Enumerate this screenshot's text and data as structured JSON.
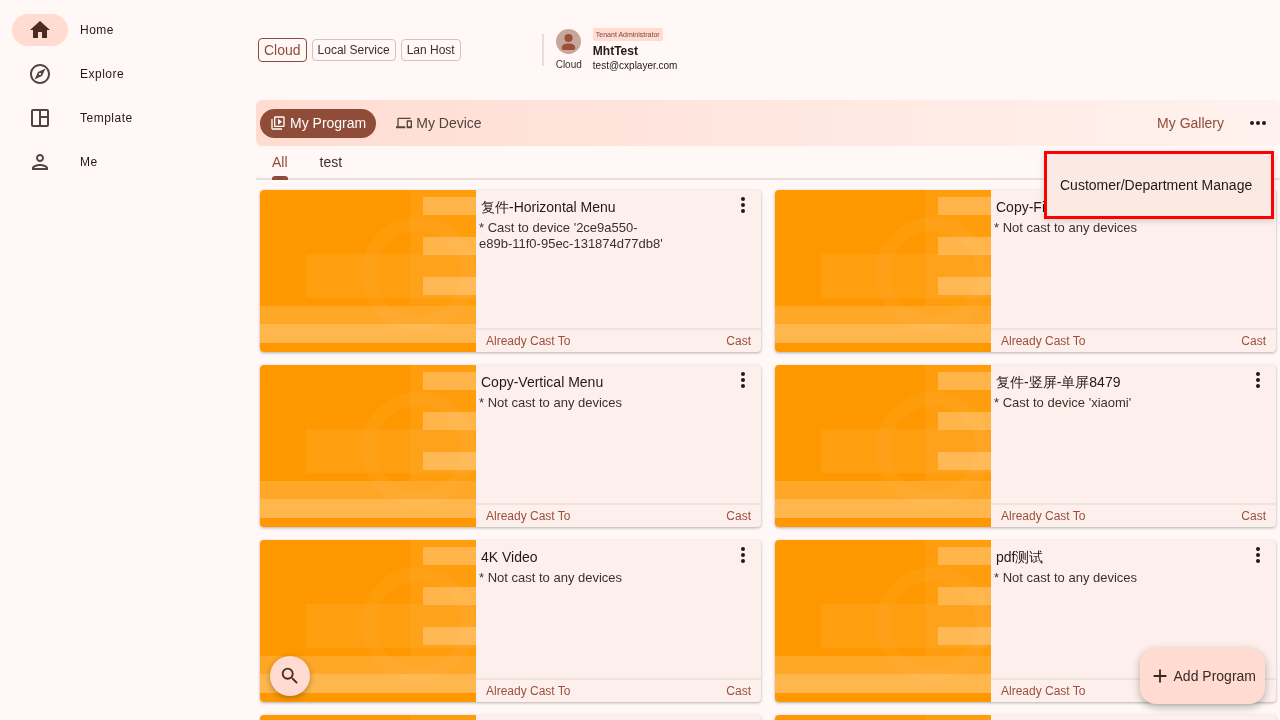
{
  "sidebar": {
    "items": [
      {
        "label": "Home",
        "selected": true
      },
      {
        "label": "Explore",
        "selected": false
      },
      {
        "label": "Template",
        "selected": false
      },
      {
        "label": "Me",
        "selected": false
      }
    ]
  },
  "header": {
    "connection_modes": [
      {
        "label": "Cloud",
        "selected": true
      },
      {
        "label": "Local Service",
        "selected": false
      },
      {
        "label": "Lan Host",
        "selected": false
      }
    ],
    "account": {
      "mode": "Cloud",
      "role": "Tenant Administrator",
      "name": "MhtTest",
      "email": "test@cxplayer.com"
    }
  },
  "tab_bar": {
    "tabs": [
      {
        "label": "My Program",
        "selected": true
      },
      {
        "label": "My Device",
        "selected": false
      }
    ],
    "gallery_link": "My Gallery"
  },
  "filter_tabs": [
    {
      "label": "All",
      "selected": true
    },
    {
      "label": "test",
      "selected": false
    }
  ],
  "menu": {
    "highlighted": true,
    "items": [
      "Customer/Department Manage"
    ]
  },
  "cards": [
    {
      "kind": "program",
      "title": "复件-Horizontal Menu",
      "description": "* Cast to device '2ce9a550-e89b-11f0-95ec-131874d77db8'",
      "footer_left": "Already Cast To",
      "footer_right": "Cast"
    },
    {
      "kind": "program",
      "title": "Copy-Fi",
      "description": "* Not cast to any devices",
      "footer_left": "Already Cast To",
      "footer_right": "Cast"
    },
    {
      "kind": "program",
      "title": "Copy-Vertical Menu",
      "description": "* Not cast to any devices",
      "footer_left": "Already Cast To",
      "footer_right": "Cast"
    },
    {
      "kind": "program",
      "title": "复件-竖屏-单屏8479",
      "description": "* Cast to device 'xiaomi'",
      "footer_left": "Already Cast To",
      "footer_right": "Cast"
    },
    {
      "kind": "program",
      "title": "4K Video",
      "description": "* Not cast to any devices",
      "footer_left": "Already Cast To",
      "footer_right": "Cast"
    },
    {
      "kind": "program",
      "title": "pdf测试",
      "description": "* Not cast to any devices",
      "footer_left": "Already Cast To"
    },
    {
      "kind": "cut_off"
    },
    {
      "kind": "cut_off"
    }
  ],
  "fab": {
    "add_label": "Add Program"
  }
}
